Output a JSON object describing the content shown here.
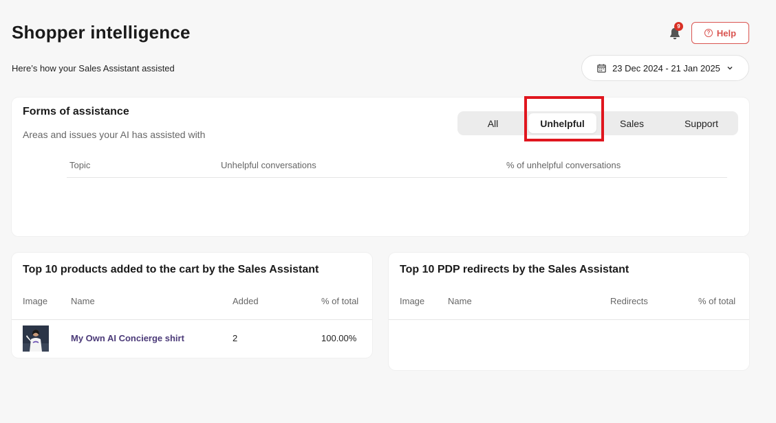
{
  "header": {
    "title": "Shopper intelligence",
    "subtitle": "Here’s how your Sales Assistant assisted",
    "notification_count": "9",
    "help_label": "Help",
    "date_range": "23 Dec 2024 - 21 Jan 2025"
  },
  "forms": {
    "title": "Forms of assistance",
    "subtitle": "Areas and issues your AI has assisted with",
    "tabs": [
      {
        "label": "All",
        "active": false
      },
      {
        "label": "Unhelpful",
        "active": true
      },
      {
        "label": "Sales",
        "active": false
      },
      {
        "label": "Support",
        "active": false
      }
    ],
    "columns": [
      "Topic",
      "Unhelpful conversations",
      "% of unhelpful conversations"
    ],
    "rows": []
  },
  "cart": {
    "title": "Top 10 products added to the cart by the Sales Assistant",
    "columns": [
      "Image",
      "Name",
      "Added",
      "% of total"
    ],
    "rows": [
      {
        "name": "My Own AI Concierge shirt",
        "added": "2",
        "pct": "100.00%"
      }
    ]
  },
  "pdp": {
    "title": "Top 10 PDP redirects by the Sales Assistant",
    "columns": [
      "Image",
      "Name",
      "Redirects",
      "% of total"
    ],
    "rows": []
  },
  "colors": {
    "accent": "#d9534f",
    "highlight": "#e0161e",
    "product_link": "#4b3a78"
  }
}
